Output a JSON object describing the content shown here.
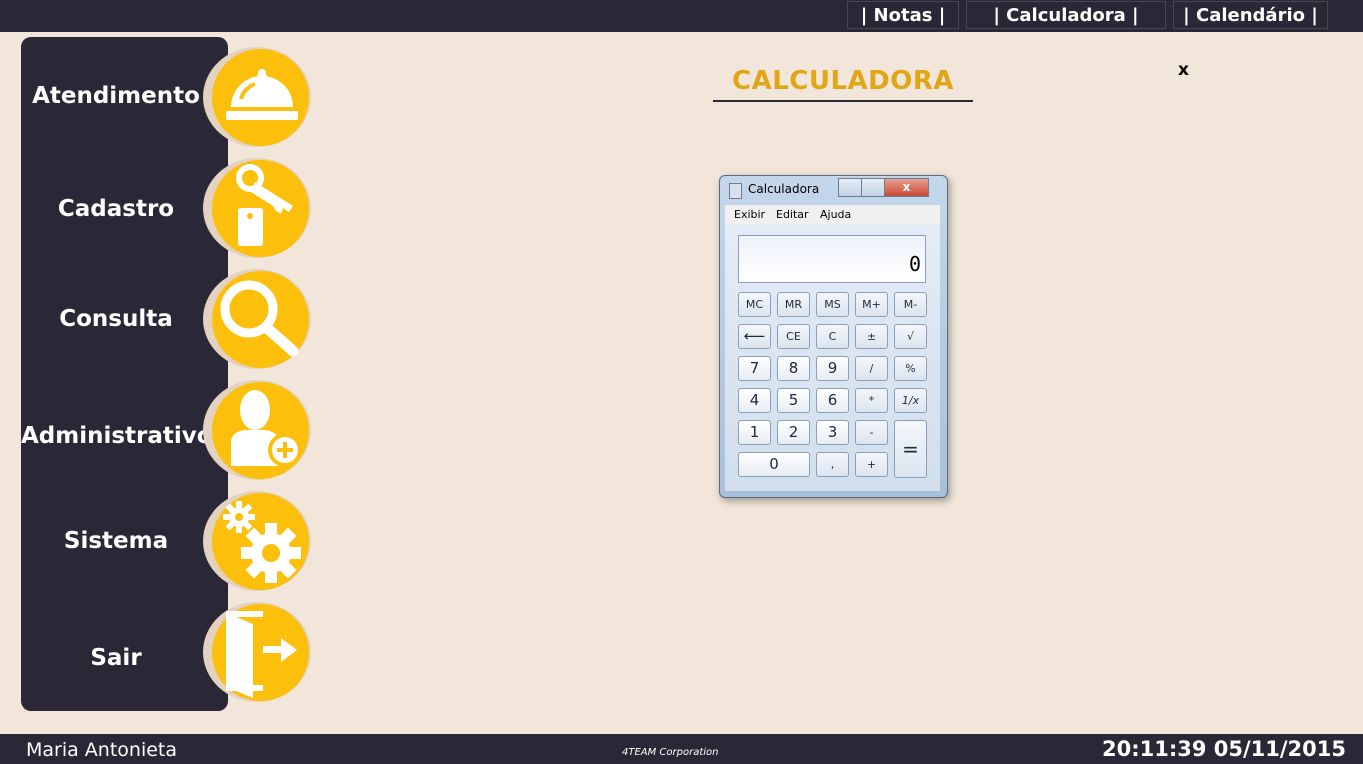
{
  "topnav": {
    "notas": "| Notas |",
    "calculadora": "| Calculadora |",
    "calendario": "| Calendário |"
  },
  "sidebar": {
    "items": [
      {
        "label": "Atendimento",
        "icon": "service-bell-icon"
      },
      {
        "label": "Cadastro",
        "icon": "key-tag-icon"
      },
      {
        "label": "Consulta",
        "icon": "magnifier-icon"
      },
      {
        "label": "Administrativo",
        "icon": "add-user-icon"
      },
      {
        "label": "Sistema",
        "icon": "gears-icon"
      },
      {
        "label": "Sair",
        "icon": "exit-door-icon"
      }
    ]
  },
  "main": {
    "title": "CALCULADORA",
    "close": "x"
  },
  "calculator": {
    "window_title": "Calculadora",
    "close_glyph": "x",
    "menu": [
      "Exibir",
      "Editar",
      "Ajuda"
    ],
    "display": "0",
    "keys": {
      "mc": "MC",
      "mr": "MR",
      "ms": "MS",
      "mplus": "M+",
      "mminus": "M-",
      "back": "⟵",
      "ce": "CE",
      "c": "C",
      "plusminus": "±",
      "sqrt": "√",
      "k7": "7",
      "k8": "8",
      "k9": "9",
      "div": "/",
      "pct": "%",
      "k4": "4",
      "k5": "5",
      "k6": "6",
      "mul": "*",
      "inv": "1/x",
      "k1": "1",
      "k2": "2",
      "k3": "3",
      "sub": "-",
      "eq": "=",
      "k0": "0",
      "comma": ",",
      "add": "+"
    }
  },
  "footer": {
    "user": "Maria Antonieta",
    "company": "4TEAM Corporation",
    "datetime": "20:11:39 05/11/2015"
  },
  "colors": {
    "background": "#f1e6d9",
    "dark": "#2a2836",
    "accent": "#fbbf0c",
    "title": "#e0a615"
  }
}
